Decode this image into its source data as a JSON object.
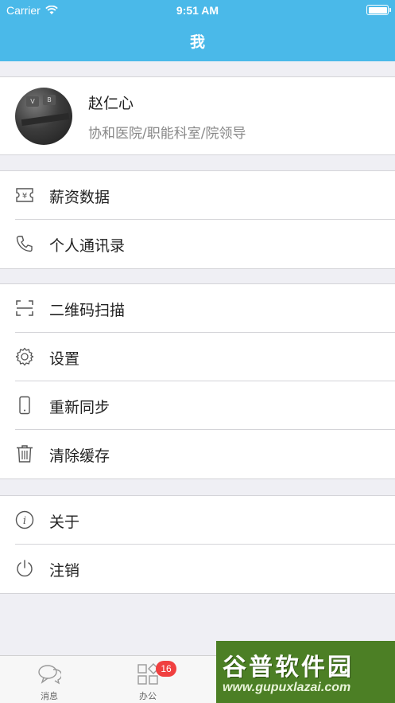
{
  "status_bar": {
    "carrier": "Carrier",
    "time": "9:51 AM"
  },
  "nav": {
    "title": "我"
  },
  "profile": {
    "name": "赵仁心",
    "org": "协和医院/职能科室/院领导"
  },
  "menu": {
    "salary": "薪资数据",
    "contacts": "个人通讯录",
    "scan": "二维码扫描",
    "settings": "设置",
    "resync": "重新同步",
    "clear_cache": "清除缓存",
    "about": "关于",
    "logout": "注销"
  },
  "tabs": {
    "messages": "消息",
    "office": "办公",
    "office_badge": "16"
  },
  "watermark": {
    "title": "谷普软件园",
    "url": "www.gupuxlazai.com"
  },
  "colors": {
    "accent": "#4ab9e9",
    "badge": "#f04040",
    "background": "#efeff4"
  }
}
